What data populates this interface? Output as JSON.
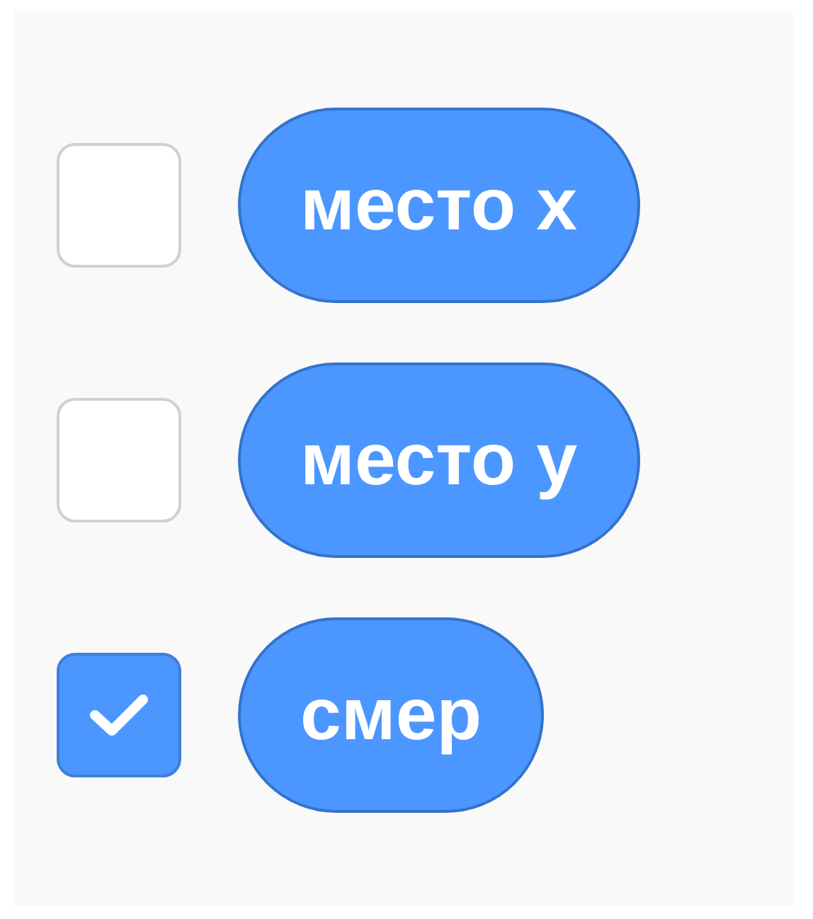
{
  "blocks": [
    {
      "label": "место x",
      "checked": false
    },
    {
      "label": "место y",
      "checked": false
    },
    {
      "label": "смер",
      "checked": true
    }
  ]
}
